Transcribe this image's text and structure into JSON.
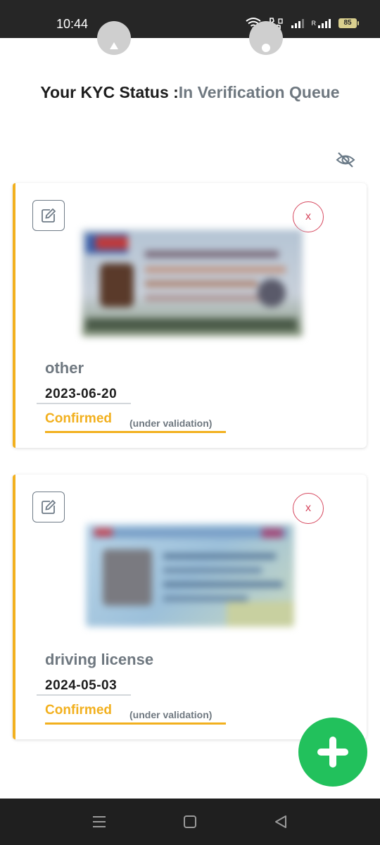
{
  "status_bar": {
    "time": "10:44",
    "battery": "85",
    "carrier_letter": "R"
  },
  "kyc": {
    "label": "Your KYC Status :",
    "value": "In Verification Queue"
  },
  "icons": {
    "eye_toggle": "eye-off-icon",
    "edit": "edit-square-icon",
    "remove": "x",
    "add": "plus-icon"
  },
  "documents": [
    {
      "type": "other",
      "date": "2023-06-20",
      "status": "Confirmed",
      "status_note": "(under validation)"
    },
    {
      "type": "driving license",
      "date": "2024-05-03",
      "status": "Confirmed",
      "status_note": "(under validation)"
    }
  ],
  "colors": {
    "accent": "#f2b01e",
    "remove": "#d6475e",
    "fab": "#22c15c",
    "muted_text": "#6f7880"
  }
}
